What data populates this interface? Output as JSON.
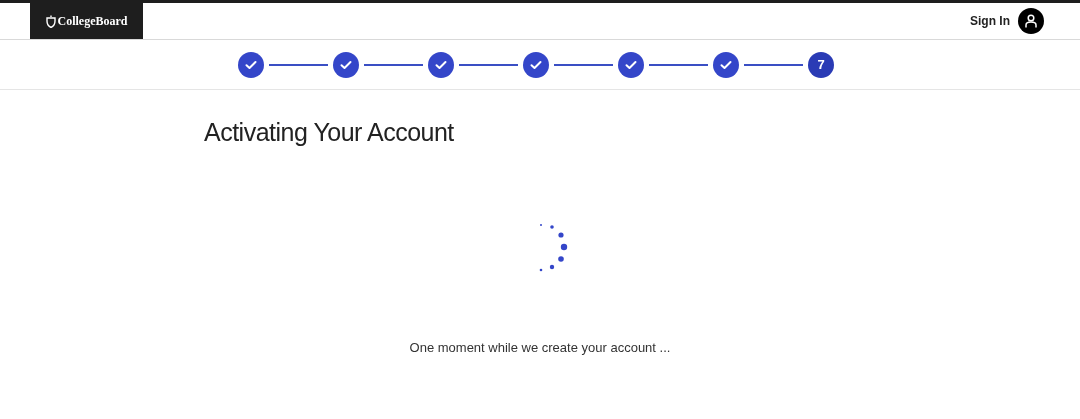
{
  "header": {
    "logo": "CollegeBoard",
    "sign_in": "Sign In"
  },
  "steps": [
    {
      "completed": true
    },
    {
      "completed": true
    },
    {
      "completed": true
    },
    {
      "completed": true
    },
    {
      "completed": true
    },
    {
      "completed": true
    },
    {
      "completed": false,
      "label": "7"
    }
  ],
  "title": "Activating Your Account",
  "message": "One moment while we create your account ..."
}
